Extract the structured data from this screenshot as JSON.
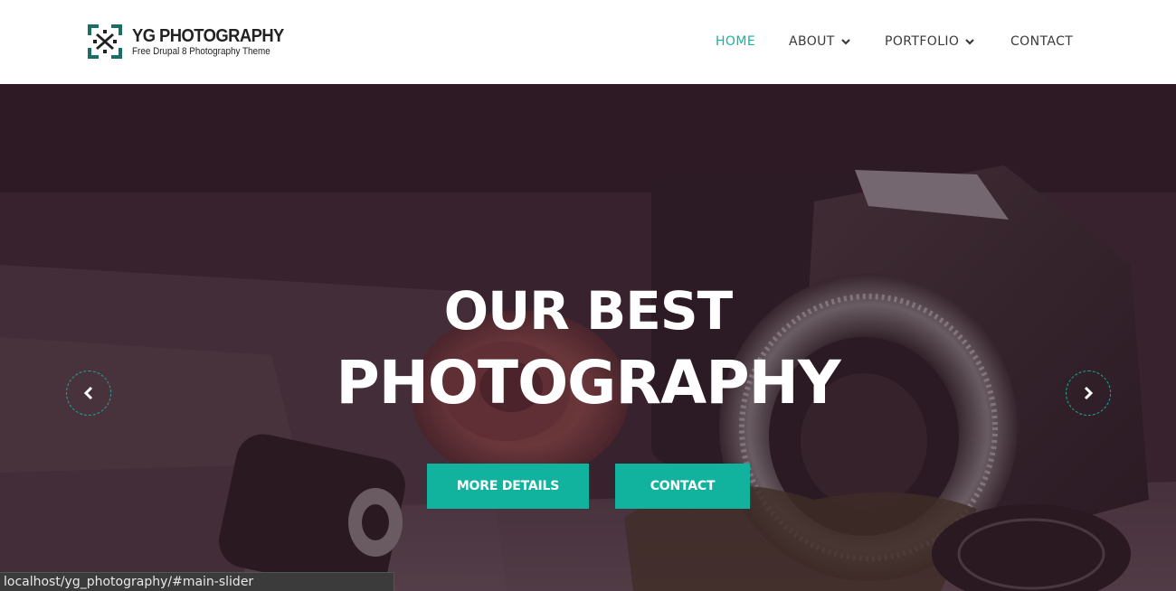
{
  "brand": {
    "title": "YG PHOTOGRAPHY",
    "tagline": "Free Drupal 8 Photography Theme",
    "accent_color": "#19b3a0"
  },
  "nav": {
    "items": [
      {
        "label": "HOME",
        "active": true,
        "has_dropdown": false
      },
      {
        "label": "ABOUT",
        "active": false,
        "has_dropdown": true
      },
      {
        "label": "PORTFOLIO",
        "active": false,
        "has_dropdown": true
      },
      {
        "label": "CONTACT",
        "active": false,
        "has_dropdown": false
      }
    ]
  },
  "hero": {
    "title_line1": "OUR BEST",
    "title_line2": "PHOTOGRAPHY",
    "buttons": {
      "more_details": "MORE DETAILS",
      "contact": "CONTACT"
    },
    "button_color": "#12b39e",
    "prev_icon": "chevron-left-icon",
    "next_icon": "chevron-right-icon"
  },
  "status_bar": {
    "url": "localhost/yg_photography/#main-slider"
  }
}
